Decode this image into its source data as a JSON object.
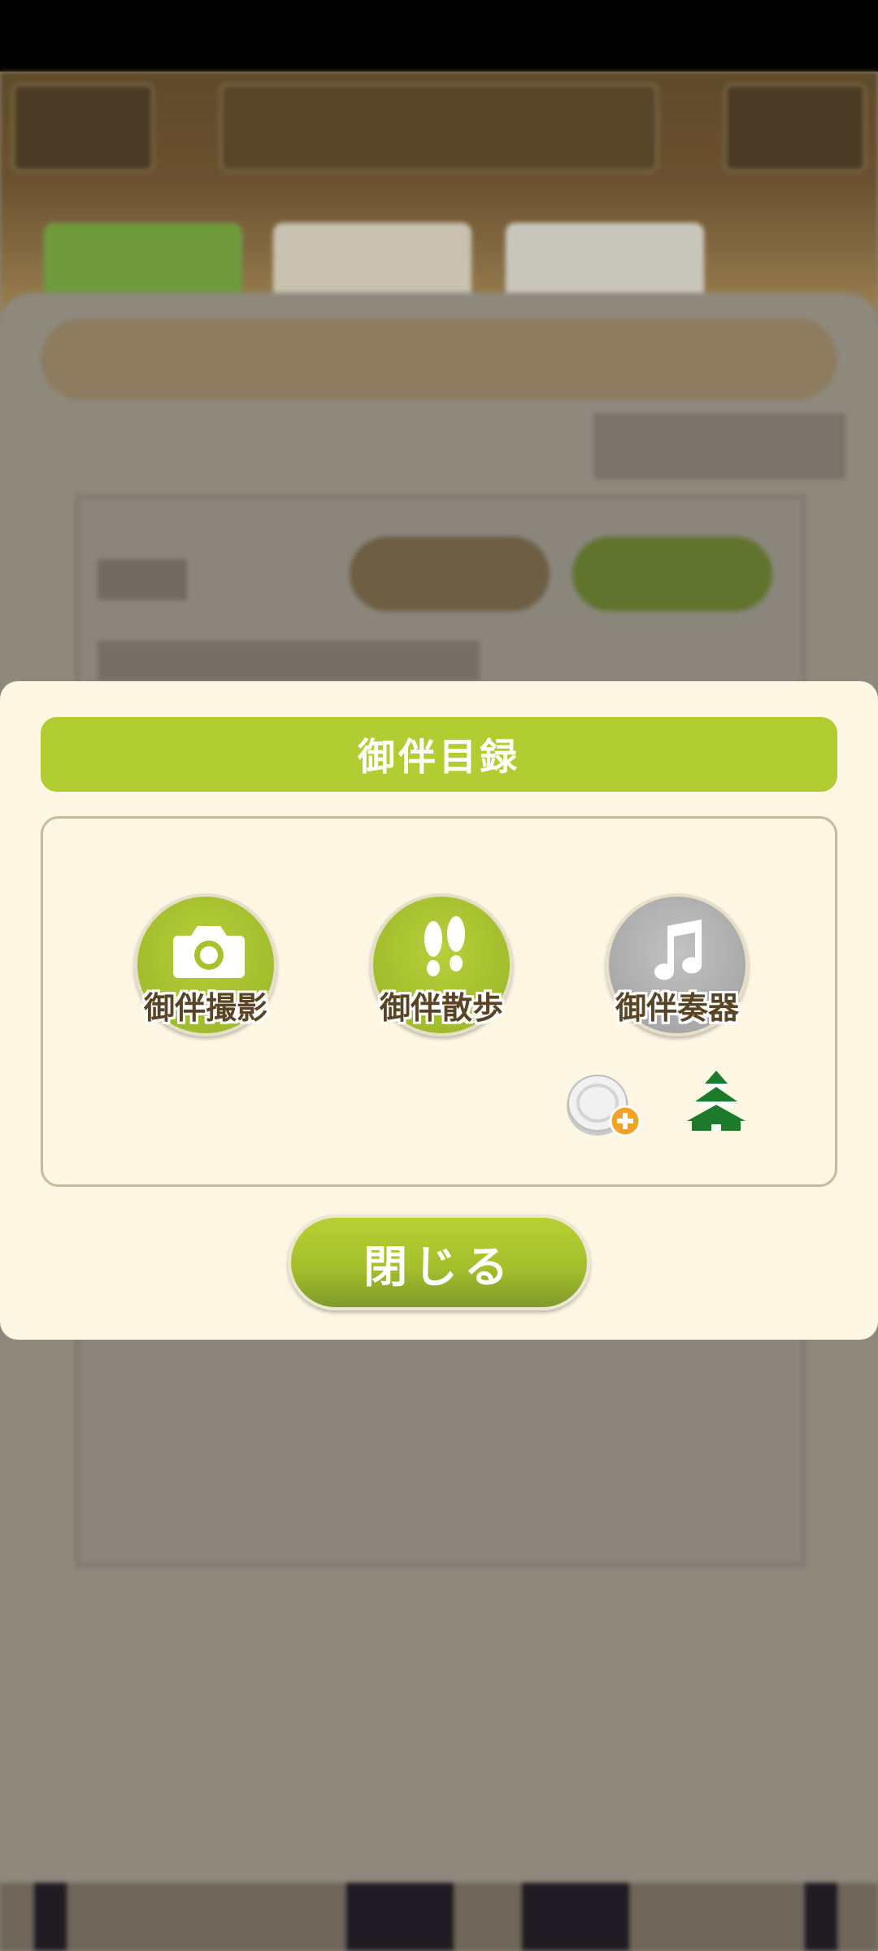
{
  "modal": {
    "title": "御伴目録",
    "items": [
      {
        "label": "御伴撮影",
        "icon": "camera-icon",
        "state": "enabled",
        "color": "#a8c22e"
      },
      {
        "label": "御伴散歩",
        "icon": "footprints-icon",
        "state": "enabled",
        "color": "#a8c22e"
      },
      {
        "label": "御伴奏器",
        "icon": "music-note-icon",
        "state": "disabled",
        "color": "#aaaaaa"
      }
    ],
    "extra_icons": [
      "coin-plus-icon",
      "castle-icon"
    ],
    "close_label": "閉じる"
  },
  "colors": {
    "accent": "#b2cd32",
    "modal_background": "#fdf6e2",
    "label_text": "#5a4426"
  }
}
